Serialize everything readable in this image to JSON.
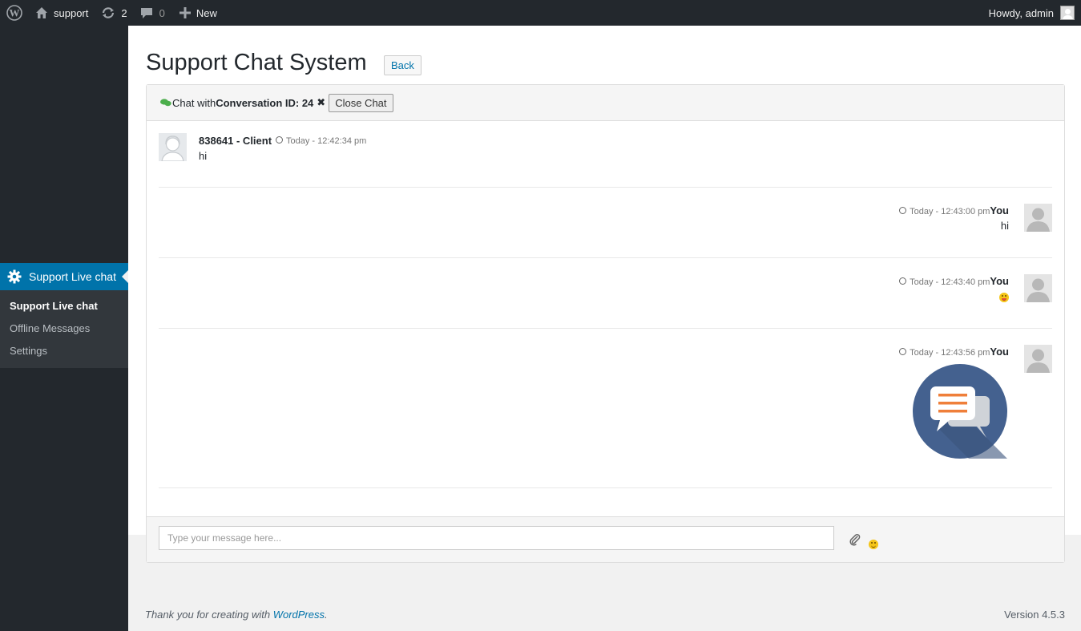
{
  "admin_bar": {
    "site_name": "support",
    "updates_count": "2",
    "comments_count": "0",
    "new_label": "New",
    "howdy": "Howdy, admin"
  },
  "sidebar": {
    "current_menu": "Support Live chat",
    "submenu": [
      {
        "label": "Support Live chat",
        "current": true
      },
      {
        "label": "Offline Messages",
        "current": false
      },
      {
        "label": "Settings",
        "current": false
      }
    ]
  },
  "page": {
    "title": "Support Chat System",
    "back_label": "Back"
  },
  "chat": {
    "header_prefix": "Chat with",
    "conversation_id": "Conversation ID: 24",
    "close_label": "Close Chat",
    "messages": [
      {
        "sender": "838641 - Client",
        "time": "Today - 12:42:34 pm",
        "text": "hi",
        "side": "left"
      },
      {
        "sender": "You",
        "time": "Today - 12:43:00 pm",
        "text": "hi",
        "side": "right"
      },
      {
        "sender": "You",
        "time": "Today - 12:43:40 pm",
        "emoji": "tongue",
        "side": "right"
      },
      {
        "sender": "You",
        "time": "Today - 12:43:56 pm",
        "image": "chat-bubbles-icon",
        "side": "right"
      }
    ],
    "input_placeholder": "Type your message here..."
  },
  "footer": {
    "thanks_prefix": "Thank you for creating with ",
    "thanks_link": "WordPress",
    "thanks_suffix": ".",
    "version": "Version 4.5.3"
  },
  "colors": {
    "admin_bar": "#23282d",
    "accent": "#0073aa",
    "submenu_bg": "#32373c"
  }
}
